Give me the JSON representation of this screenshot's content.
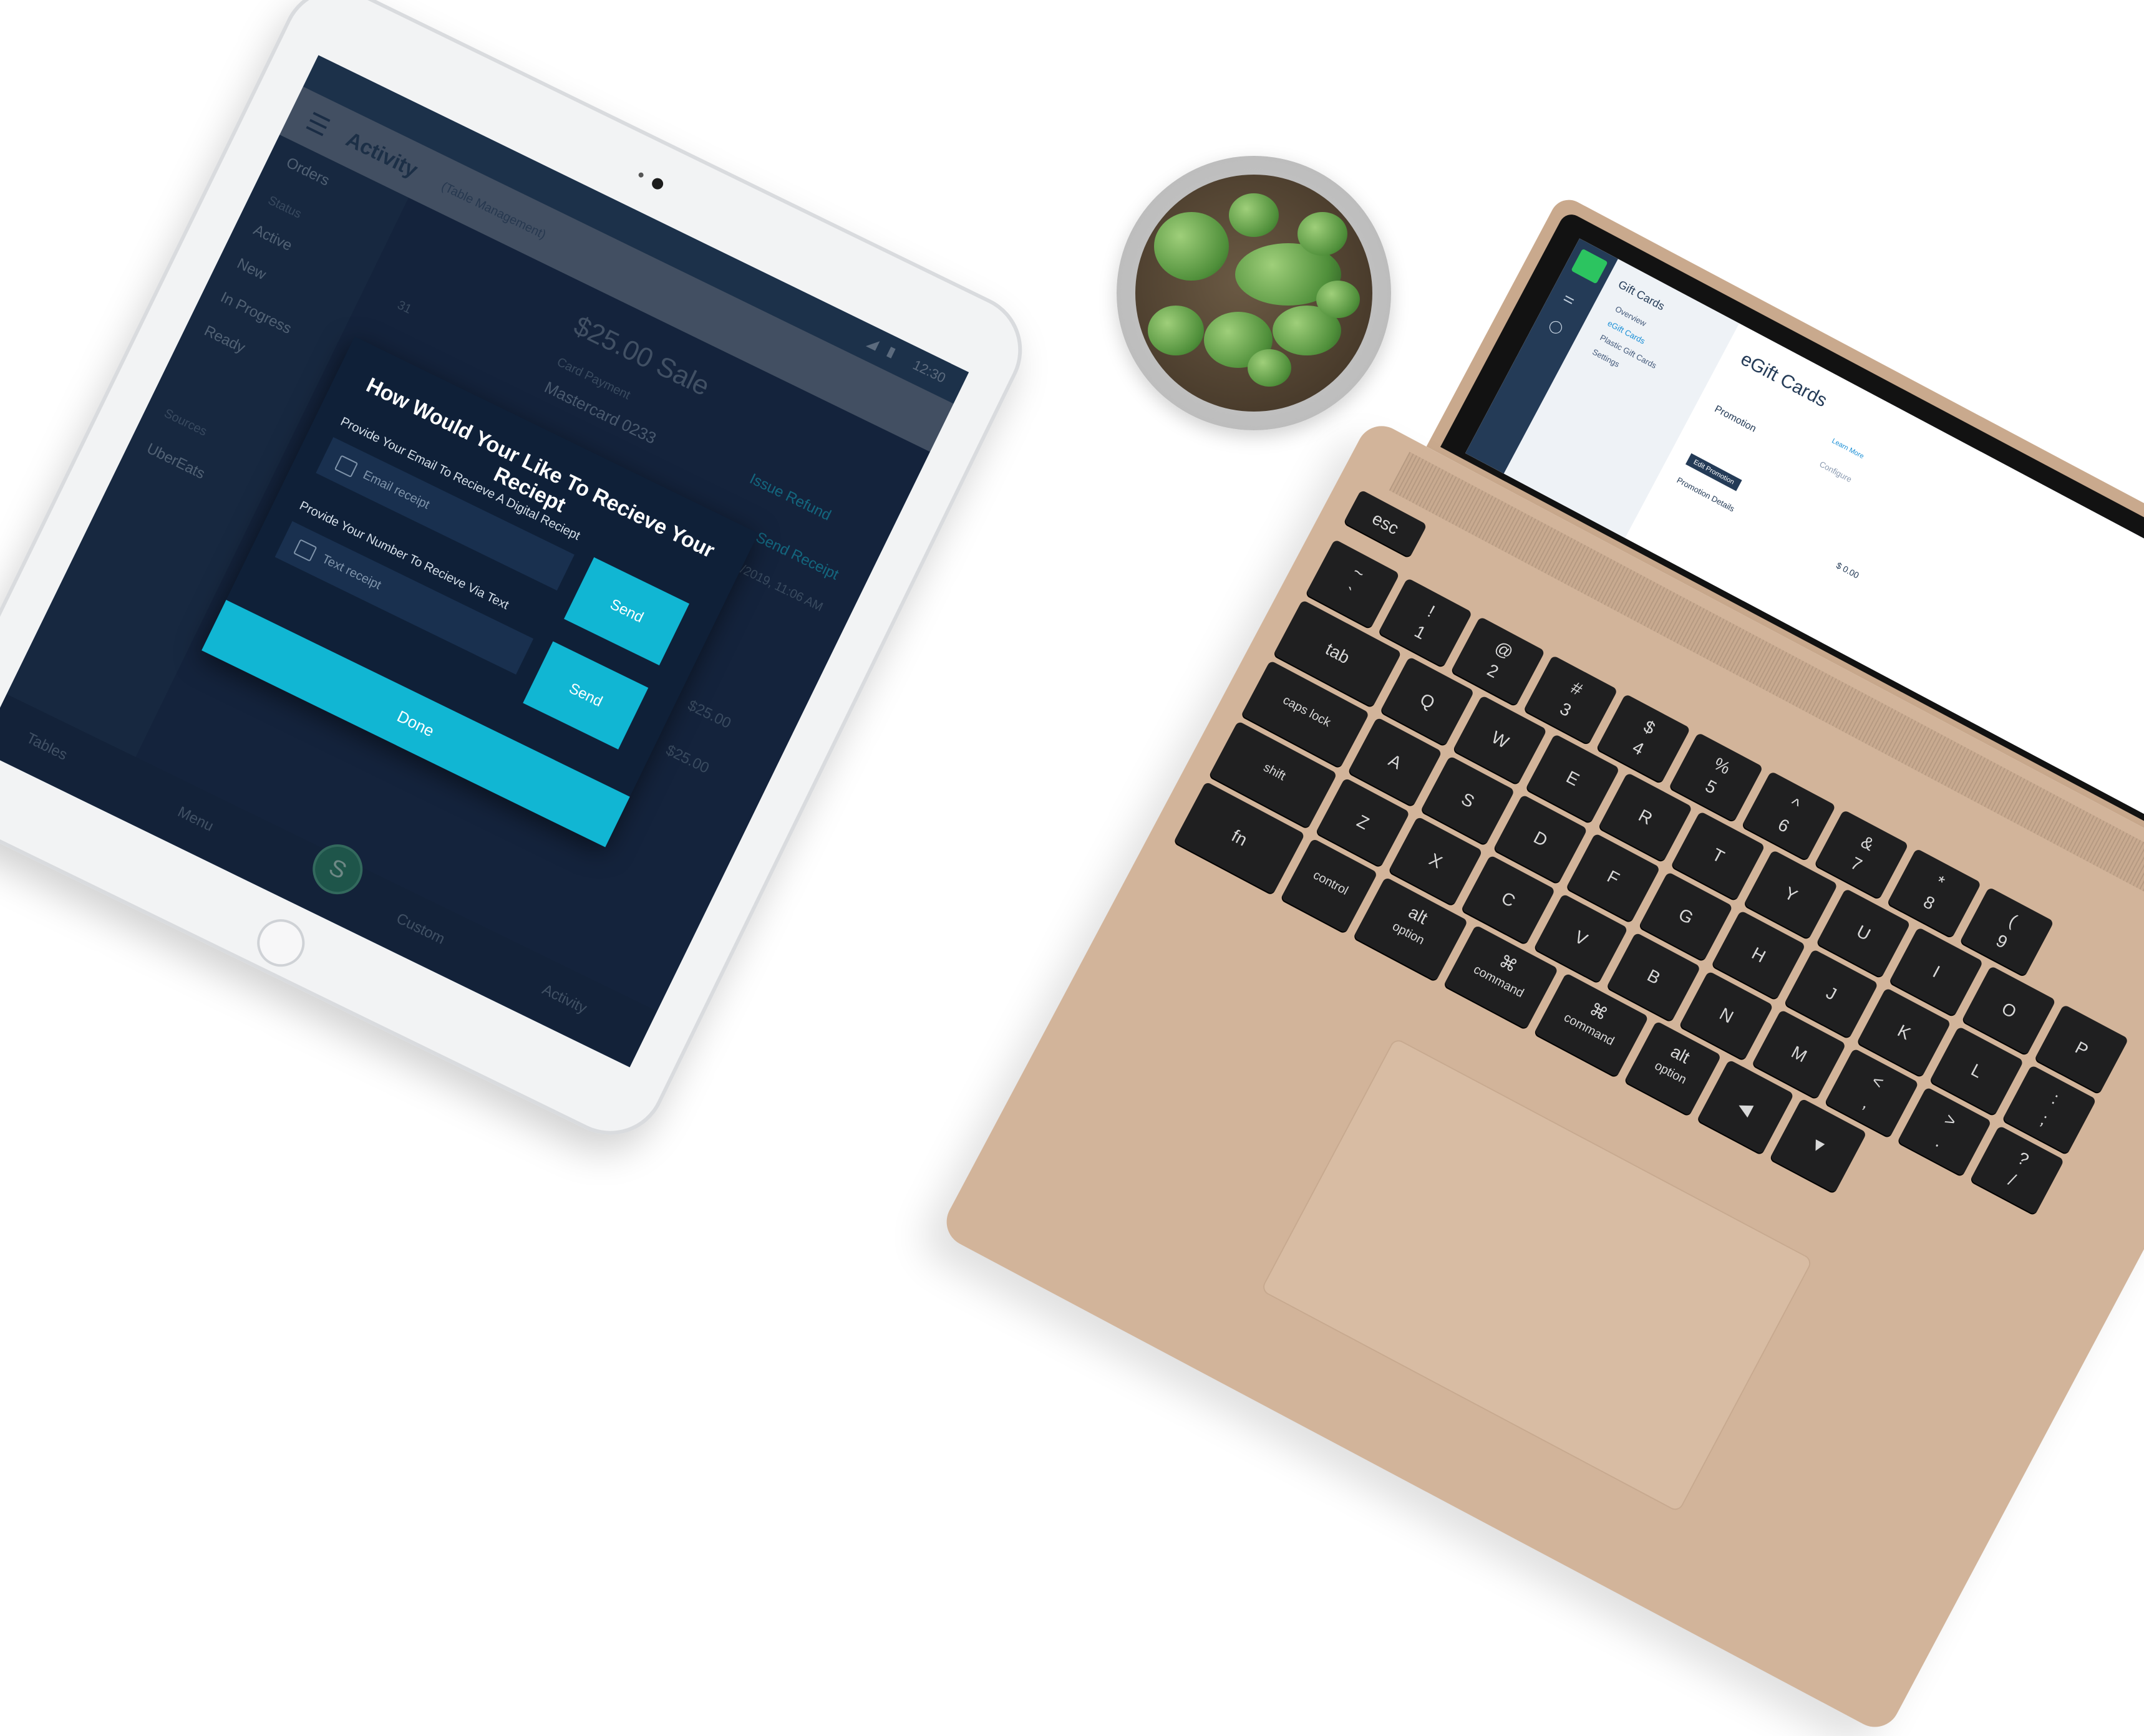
{
  "ipad": {
    "status_time": "12:30",
    "appbar": {
      "title": "Activity",
      "subtitle": "(Table Management)"
    },
    "sidebar": {
      "orders_label": "Orders",
      "status_label": "Status",
      "items": [
        "Active",
        "New",
        "In Progress",
        "Ready"
      ],
      "sources_label": "Sources",
      "source_item": "UberEats"
    },
    "content": {
      "sale_amount": "$25.00 Sale",
      "card_payment_label": "Card Payment",
      "card_name": "Mastercard 0233",
      "issue_refund": "Issue Refund",
      "send_receipt": "Send Receipt",
      "transaction_meta": "22/01/2019, 11:06 AM",
      "line_amount_1": "$25.00",
      "line_amount_2": "$25.00",
      "row_count": "31"
    },
    "dialog": {
      "question": "How Would Your Like To Recieve Your Reciept",
      "email_label": "Provide Your Email To Recieve A Digital Reciept",
      "email_placeholder": "Email receipt",
      "email_send": "Send",
      "phone_label": "Provide Your Number To Recieve Via Text",
      "phone_placeholder": "Text receipt",
      "phone_send": "Send",
      "done": "Done"
    },
    "bottom_nav": [
      "Tables",
      "Menu",
      "Custom",
      "Activity"
    ]
  },
  "laptop": {
    "sidebar": {
      "heading": "Gift Cards",
      "items": [
        "Overview",
        "eGift Cards",
        "Plastic Gift Cards",
        "Settings"
      ]
    },
    "main": {
      "title": "eGift Cards",
      "promotion_heading": "Promotion",
      "configure_label": "Configure",
      "learn_more": "Learn More",
      "promotion_details": "Promotion Details",
      "price_value": "$ 0.00",
      "action_button": "Edit Promotion"
    },
    "keys": {
      "row1": [
        "esc"
      ],
      "row2": [
        "~\n`",
        "!\n1",
        "@\n2",
        "#\n3",
        "$\n4",
        "%\n5",
        "^\n6",
        "&\n7",
        "*\n8",
        "(\n9"
      ],
      "row3": [
        "tab",
        "Q",
        "W",
        "E",
        "R",
        "T",
        "Y",
        "U",
        "I",
        "O",
        "P"
      ],
      "row4": [
        "caps lock",
        "A",
        "S",
        "D",
        "F",
        "G",
        "H",
        "J",
        "K",
        "L",
        ":\n;"
      ],
      "row5": [
        "shift",
        "Z",
        "X",
        "C",
        "V",
        "B",
        "N",
        "M",
        "<\n,",
        ">\n.",
        "?\n/"
      ],
      "row6": [
        "fn",
        "control",
        "alt\noption",
        "⌘\ncommand",
        "⌘\ncommand",
        "alt\noption",
        "◀",
        "▼"
      ]
    }
  }
}
